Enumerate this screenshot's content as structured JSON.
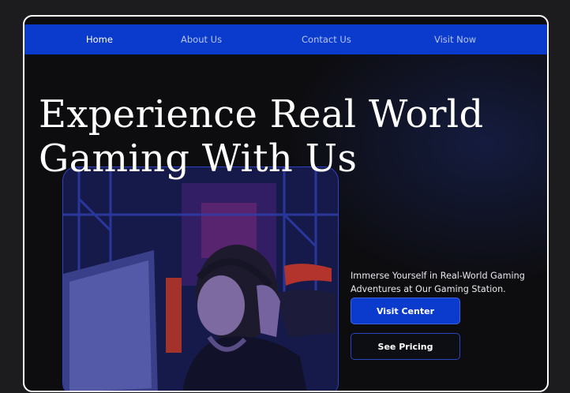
{
  "nav": {
    "items": [
      {
        "label": "Home",
        "active": true
      },
      {
        "label": "About Us",
        "active": false
      },
      {
        "label": "Contact Us",
        "active": false
      },
      {
        "label": "Visit Now",
        "active": false
      }
    ]
  },
  "hero": {
    "title_line1": "Experience Real World",
    "title_line2": "Gaming With Us",
    "tagline": "Immerse Yourself in Real-World Gaming Adventures at Our Gaming Station.",
    "primary_button": "Visit Center",
    "secondary_button": "See Pricing"
  },
  "colors": {
    "accent": "#0b3bcc",
    "background": "#0d0d10",
    "frame_border": "#ffffff"
  }
}
